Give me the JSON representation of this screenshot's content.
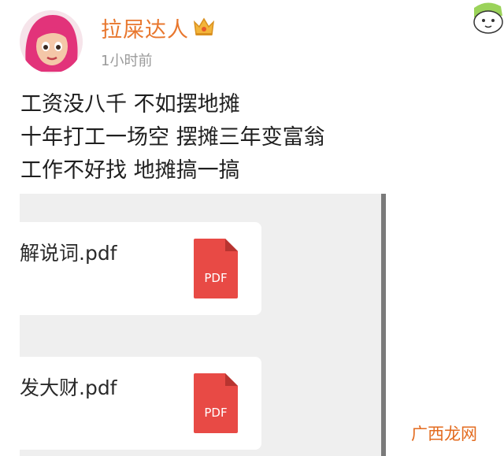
{
  "post": {
    "author": "拉屎达人",
    "time": "1小时前",
    "lines": [
      "工资没八千 不如摆地摊",
      "十年打工一场空 摆摊三年变富翁",
      "工作不好找 地摊搞一搞"
    ]
  },
  "attachments": [
    {
      "name": "解说词.pdf",
      "icon": "PDF"
    },
    {
      "name": "发大财.pdf",
      "icon": "PDF"
    }
  ],
  "watermark": "广西龙网",
  "colors": {
    "author": "#e8772e",
    "pdf_red": "#e84a45",
    "watermark": "#e36b1f"
  }
}
